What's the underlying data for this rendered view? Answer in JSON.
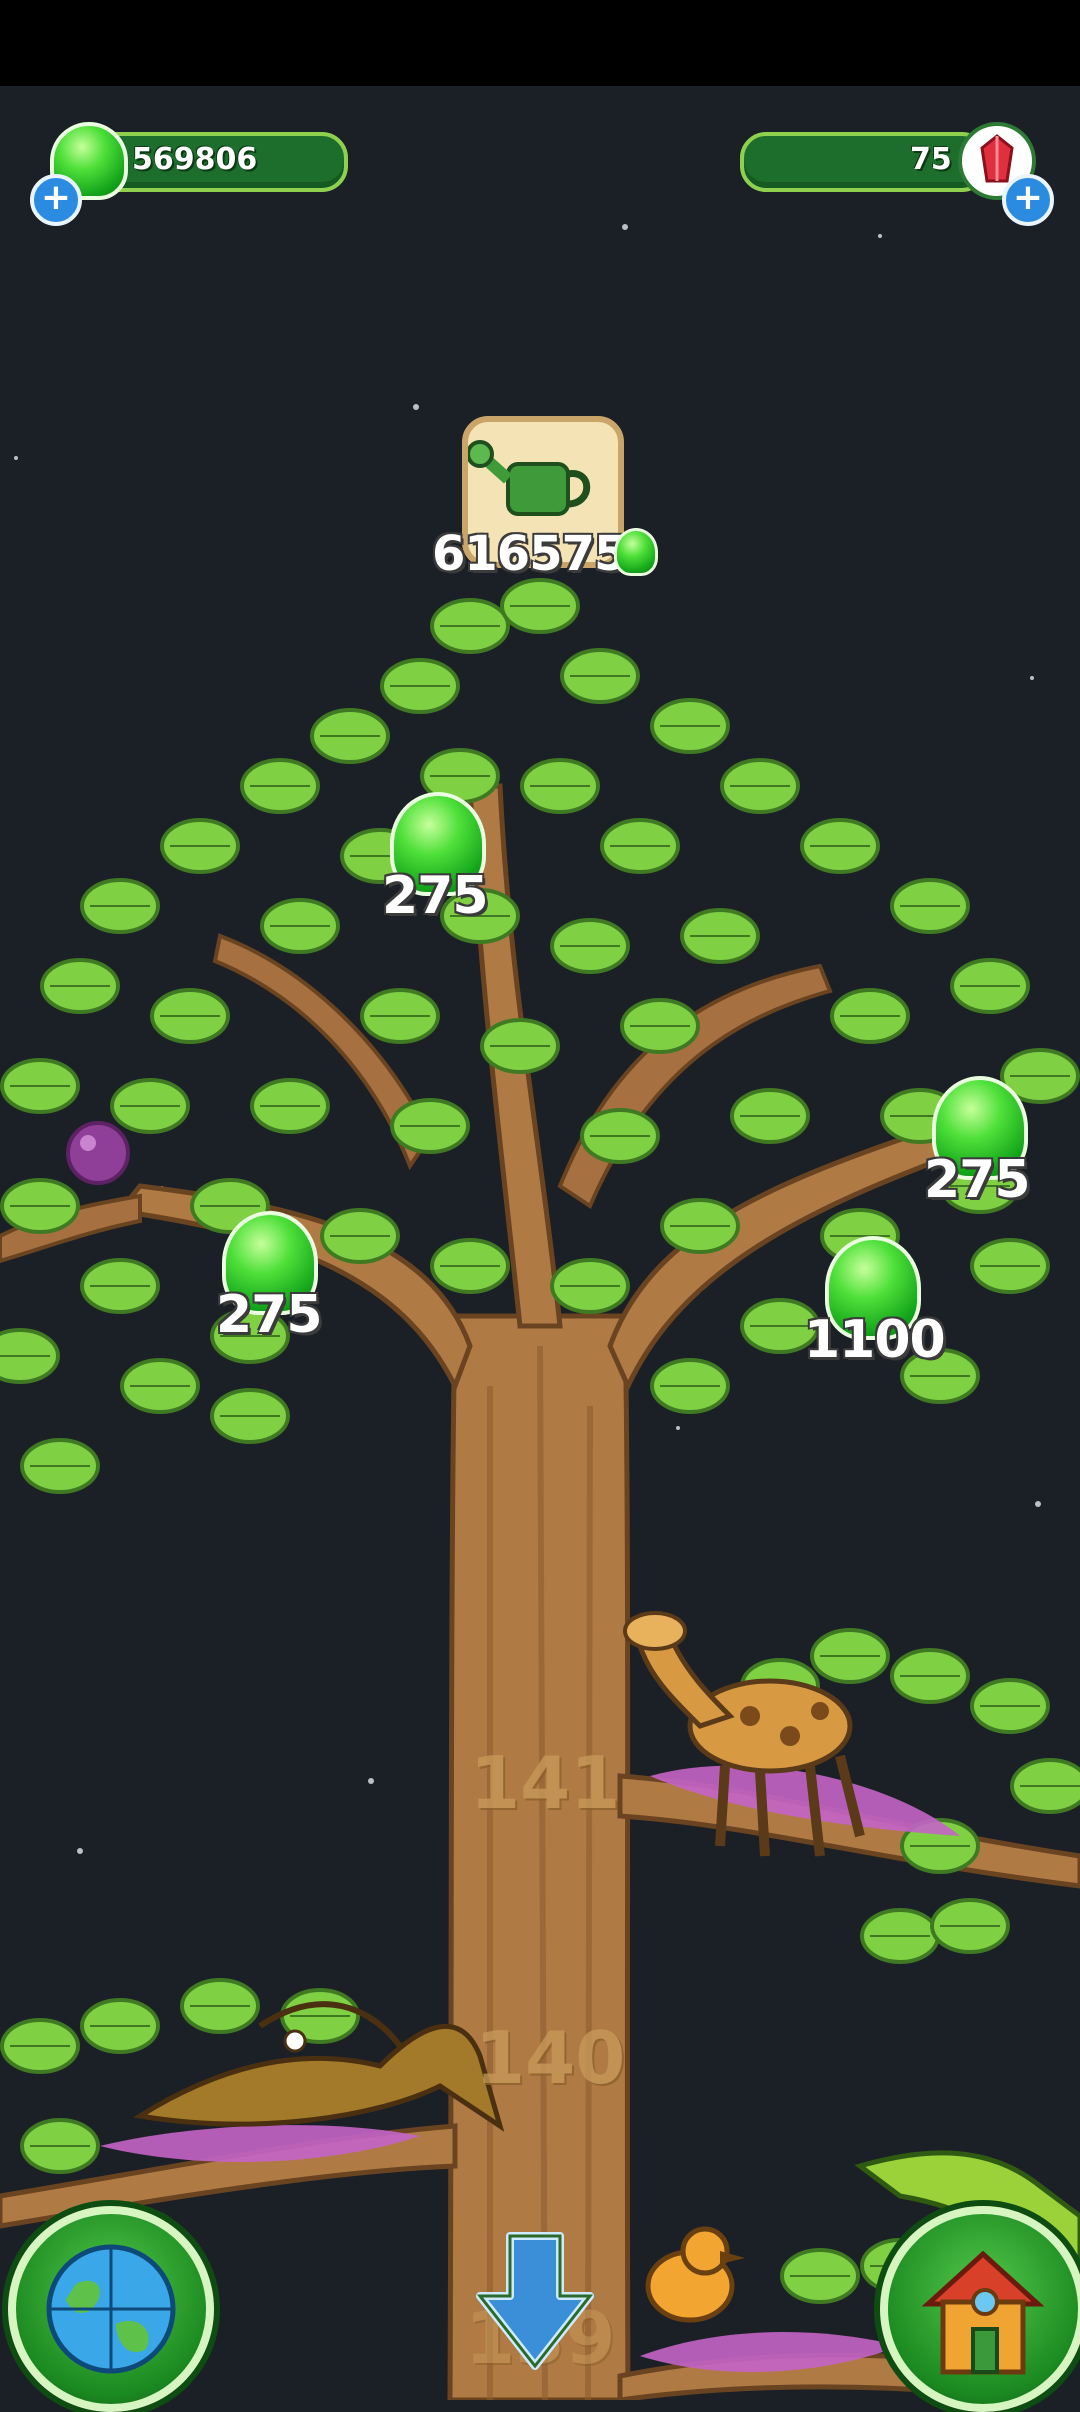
{
  "resources": {
    "slime_amount": "569806",
    "gem_amount": "75"
  },
  "upgrade": {
    "cost": "616575",
    "icon": "watering-can-icon"
  },
  "fruit_rewards": [
    {
      "value": "275"
    },
    {
      "value": "275"
    },
    {
      "value": "275"
    },
    {
      "value": "1100"
    }
  ],
  "branch_levels": [
    "141",
    "140",
    "139"
  ],
  "buttons": {
    "world_map": "globe-icon",
    "scroll_down": "arrow-down-icon",
    "home": "house-icon"
  },
  "colors": {
    "background": "#1b2026",
    "trunk": "#b07a45",
    "leaves": "#6fc23a",
    "slime": "#2fd12f"
  }
}
